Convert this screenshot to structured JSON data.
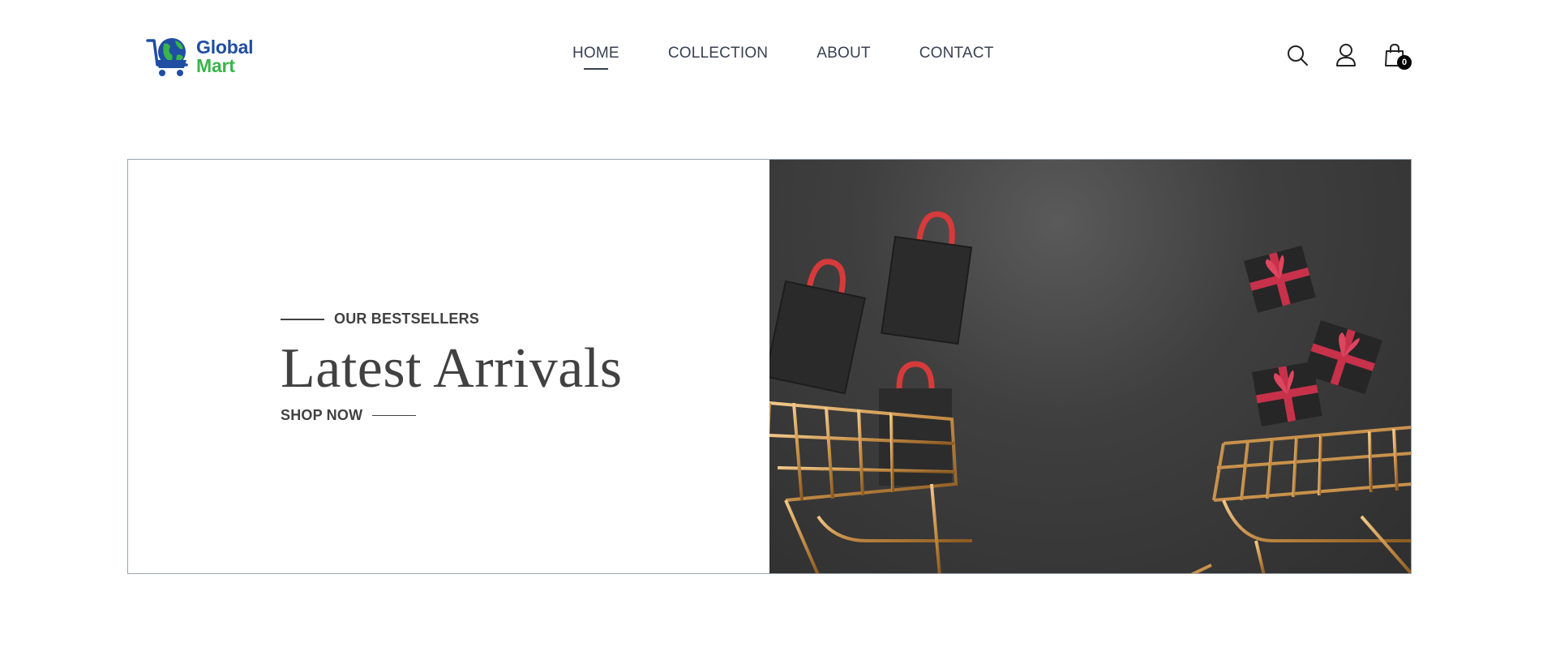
{
  "brand": {
    "line1": "Global",
    "line2": "Mart"
  },
  "nav": {
    "links": [
      {
        "label": "HOME",
        "active": true
      },
      {
        "label": "COLLECTION",
        "active": false
      },
      {
        "label": "ABOUT",
        "active": false
      },
      {
        "label": "CONTACT",
        "active": false
      }
    ]
  },
  "icons": {
    "search": "search-icon",
    "profile": "user-icon",
    "cart": "shopping-bag-icon",
    "cart_count": "0"
  },
  "hero": {
    "eyebrow": "OUR BESTSELLERS",
    "title": "Latest Arrivals",
    "cta": "SHOP NOW",
    "image_alt": "shopping bags, gift boxes and golden carts on dark background"
  },
  "colors": {
    "brand_blue": "#1f4ea3",
    "brand_green": "#39b54a",
    "text_dark": "#414141",
    "nav_text": "#374151",
    "border": "#9ca3af"
  }
}
